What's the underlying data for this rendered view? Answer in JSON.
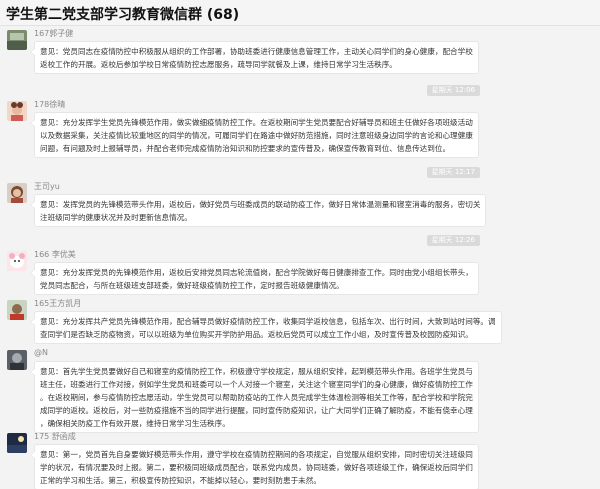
{
  "window": {
    "title": "学生第二党支部学习教育微信群 (68)"
  },
  "messages": [
    {
      "sender": "167郭子健",
      "lines": [
        "意见：党员同志在疫情防控中积极服从组织的工作部署，协助班委进行健康信息管理工作，主动关心同学们的身心健康，配合学校",
        "返校工作的开展。返校后参加学校日常疫情防控志愿服务，疏导同学就餐及上课，维持日常学习生活秩序。"
      ]
    },
    {
      "time": "星期天 12:06",
      "sender": "178徐晴",
      "lines": [
        "意见：充分发挥学生党员先锋模范作用，做实做细疫情防控工作。在返校期间学生党员要配合好辅导员和班主任做好各项班级活动",
        "以及数据采集，关注疫情比较重地区的同学的情况，可履同学们在路途中做好防范措施，同时注意班级身边同学的言论和心理健康",
        "问题，有问题及时上报辅导员，并配合老师完成疫情防治知识和防控要求的宣传普及，确保宣传教育到位、信息传达到位。"
      ]
    },
    {
      "time": "星期天 12:17",
      "sender": "王司yu",
      "lines": [
        "意见：发挥党员的先锋模范带头作用，返校后，做好党员与班委成员的联动防疫工作，做好日常体温测量和寝室消毒的服务，密切关",
        "注班级同学的健康状况并及时更新信息情况。"
      ]
    },
    {
      "time": "星期天 12:26",
      "sender": "166 李优美",
      "lines": [
        "意见：充分发挥党员的先锋模范作用，返校后安排党员同志轮流值岗，配合学院做好每日健康排查工作。同时由党小组组长带头，",
        "党员同志配合，与所在班级班支部班委，做好班级疫情防控工作，定时报告班级健康情况。"
      ]
    },
    {
      "sender": "165王方凯月",
      "lines": [
        "意见：充分发挥共产党员先锋模范作用，配合辅导员做好疫情防控工作，收集同学返校信息，包括车次、出行时间，大致到站时间等。调",
        "查同学们是否缺乏防疫物资，可以以班级为单位购买开学防护用品。返校后党员可以成立工作小组，及时宣传普及校园防疫知识。"
      ]
    },
    {
      "sender": "@N",
      "lines": [
        "意见：首先学生党员要做好自己和寝室的疫情防控工作，积极遵守学校规定，服从组织安排，起到模范带头作用。各班学生党员与",
        "班主任，班委进行工作对接，例如学生党员和班委可以一个人对接一个寝室，关注这个寝室同学们的身心健康，做好疫情防控工作",
        "。在返校期间，参与疫情防控志愿活动，学生党员可以帮助防疫站的工作人员完成学生体温检测等相关工作等，配合学校和学院完",
        "成同学的返校。返校后，对一些防疫措施不当的同学进行提醒，同时宣传防疫知识，让广大同学们正确了解防疫，不能有侥幸心理",
        "，确保相关防疫工作有效开展，维持日常学习生活秩序。"
      ]
    },
    {
      "sender": "175 舒函成",
      "lines": [
        "意见：第一，党员首先自身要做好模范带头作用，遵守学校在疫情防控期间的各项规定，自觉服从组织安排，同时密切关注班级同",
        "学的状况，有情况要及时上报。第二，要积极同班级成员配合，联系党内成员，协同班委，做好各项班级工作，确保返校后同学们",
        "正常的学习和生活。第三，积极宣传防控知识，不能掉以轻心，要时刻防患于未然。"
      ]
    }
  ]
}
